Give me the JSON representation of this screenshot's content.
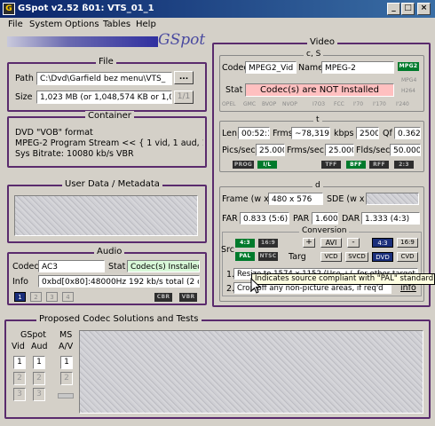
{
  "window": {
    "title": "GSpot v2.52 ß01: VTS_01_1",
    "btn_min": "_",
    "btn_max": "□",
    "btn_close": "×"
  },
  "menu": [
    "File",
    "System",
    "Options",
    "Tables",
    "Help"
  ],
  "logo_text": "GSpot",
  "file": {
    "title": "File",
    "path_label": "Path",
    "path_value": "C:\\Dvd\\Garfield bez menu\\VTS_",
    "browse_label": "...",
    "size_label": "Size",
    "size_value": "1,023 MB (or 1,048,574 KB or 1,0",
    "part_label": "1/1"
  },
  "container": {
    "title": "Container",
    "lines": [
      "DVD \"VOB\" format",
      "MPEG-2 Program Stream << { 1 vid, 1 aud, 1 othe",
      "Sys Bitrate: 10080 kb/s VBR"
    ]
  },
  "userdata": {
    "title": "User Data / Metadata"
  },
  "audio": {
    "title": "Audio",
    "codec_label": "Codec",
    "codec_value": "AC3",
    "stat_label": "Stat",
    "stat_value": "Codec(s) Installed",
    "info_label": "Info",
    "info_value": "0xbd[0x80]:48000Hz  192 kb/s total (2 chnl",
    "streams": [
      "1",
      "2",
      "3",
      "4"
    ],
    "tags": [
      "CBR",
      "VBR"
    ]
  },
  "proposed": {
    "title": "Proposed Codec Solutions and Tests",
    "gspot_label": "GSpot",
    "ms_label": "MS",
    "vid_label": "Vid",
    "aud_label": "Aud",
    "av_label": "A/V",
    "vid_nums": [
      "1",
      "2",
      "3"
    ],
    "aud_nums": [
      "1",
      "2",
      "3"
    ],
    "av_nums": [
      "1",
      "2"
    ]
  },
  "video": {
    "title": "Video",
    "cs_label": "c, S",
    "codec_label": "Codec",
    "codec_value": "MPEG2_Vid",
    "name_label": "Name",
    "name_value": "MPEG-2",
    "stat_label": "Stat",
    "stat_value": "Codec(s) are NOT Installed",
    "codec_tags": [
      "MPG2",
      "MPG4",
      "H264"
    ],
    "fourcc_tags": [
      "OPEL",
      "GMC",
      "BVOP",
      "NVOP",
      "I7O3",
      "FCC",
      "I'70",
      "I'170",
      "I'240"
    ],
    "t_label": "t",
    "len_label": "Len",
    "len_value": "00:52:1",
    "frms_label": "Frms",
    "frms_value": "~78,319",
    "kbps_label": "kbps",
    "kbps_value": "2500",
    "qf_label": "Qf",
    "qf_value": "0.362",
    "pics_label": "Pics/sec",
    "pics_value": "25.000",
    "frms_sec_label": "Frms/sec",
    "frms_sec_value": "25.000",
    "flds_label": "Flds/sec",
    "flds_value": "50.000",
    "t_tags": [
      "PROG",
      "I/L",
      "TFF",
      "BFF",
      "RFF",
      "2:3"
    ],
    "d_label": "d",
    "frame_label": "Frame (w x",
    "frame_value": "480 x 576",
    "sde_label": "SDE (w x",
    "far_label": "FAR",
    "far_value": "0.833 (5:6)",
    "par_label": "PAR",
    "par_value": "1.600",
    "dar_label": "DAR",
    "dar_value": "1.333 (4:3)",
    "conversion_label": "Conversion",
    "src_label": "Src",
    "src_ratio_1": "4:3",
    "src_ratio_2": "16:9",
    "src_pal": "PAL",
    "src_ntsc": "NTSC",
    "targ_label": "Targ",
    "targ_plus": "+",
    "targ_avi": "AVI",
    "targ_minus": "-",
    "targ_43": "4:3",
    "targ_169": "16:9",
    "targ_vcd": "VCD",
    "targ_svcd": "SVCD",
    "targ_dvd": "DVD",
    "targ_cvd": "CVD",
    "step1_num": "1.",
    "step1_text": "Resize to 1574 x 1152 (Use +/- for other target si",
    "step2_num": "2.",
    "step2_text": "Crop off any non-picture areas, if req'd",
    "info_link": "info",
    "tooltip": "Indicates source compliant with \"PAL\" standard (e."
  },
  "colors": {
    "frame_border": "#5a2b6d",
    "stat_bad_bg": "#ffc0c0",
    "stat_good_bg": "#d8f8d8",
    "tag_on": "#007a2c",
    "tag_off": "#2e2e2e",
    "select_blue": "#1a2e7a"
  }
}
